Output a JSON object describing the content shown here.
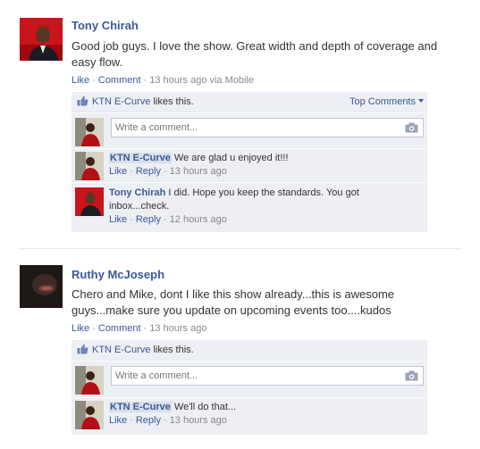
{
  "posts": [
    {
      "author": "Tony Chirah",
      "text": "Good job guys. I love the show. Great width and depth of coverage and easy flow.",
      "meta": {
        "like": "Like",
        "comment": "Comment",
        "time": "13 hours ago via Mobile"
      },
      "likes": {
        "who": "KTN E-Curve",
        "suffix": " likes this.",
        "top_comments": "Top Comments"
      },
      "write_placeholder": "Write a comment...",
      "replies": [
        {
          "name": "KTN E-Curve",
          "text": "We are glad u enjoyed it!!!",
          "like": "Like",
          "reply": "Reply",
          "time": "13 hours ago"
        },
        {
          "name": "Tony Chirah",
          "text": "I did. Hope you keep the standards. You got inbox...check.",
          "like": "Like",
          "reply": "Reply",
          "time": "12 hours ago"
        }
      ]
    },
    {
      "author": "Ruthy McJoseph",
      "text": "Chero and Mike, dont I like this show already...this is awesome guys...make sure you update on upcoming events too....kudos",
      "meta": {
        "like": "Like",
        "comment": "Comment",
        "time": "13 hours ago"
      },
      "likes": {
        "who": "KTN E-Curve",
        "suffix": " likes this."
      },
      "write_placeholder": "Write a comment...",
      "replies": [
        {
          "name": "KTN E-Curve",
          "text": "We'll do that...",
          "like": "Like",
          "reply": "Reply",
          "time": "13 hours ago"
        }
      ]
    }
  ],
  "colors": {
    "link": "#3b5998",
    "ufi_background": "#edeff4",
    "muted": "#888888"
  },
  "icons": {
    "like": "thumbs-up-icon",
    "camera": "camera-icon",
    "top_comments": "chevron-down-icon"
  }
}
